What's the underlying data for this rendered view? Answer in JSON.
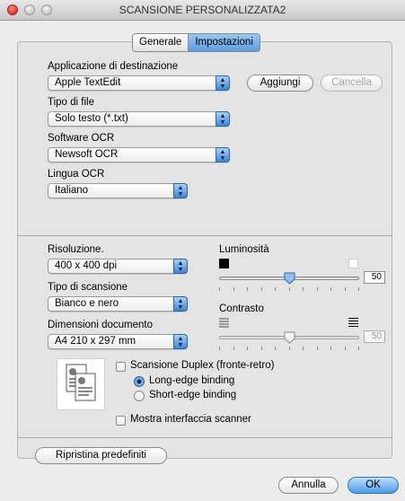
{
  "window": {
    "title": "SCANSIONE PERSONALIZZATA2"
  },
  "tabs": {
    "general": "Generale",
    "settings": "Impostazioni"
  },
  "destination": {
    "label": "Applicazione di destinazione",
    "value": "Apple TextEdit",
    "add_button": "Aggiungi",
    "delete_button": "Cancella"
  },
  "file_type": {
    "label": "Tipo di file",
    "value": "Solo testo (*.txt)"
  },
  "ocr_software": {
    "label": "Software OCR",
    "value": "Newsoft OCR"
  },
  "ocr_language": {
    "label": "Lingua OCR",
    "value": "Italiano"
  },
  "resolution": {
    "label": "Risoluzione.",
    "value": "400 x 400 dpi"
  },
  "scan_type": {
    "label": "Tipo di scansione",
    "value": "Bianco e nero"
  },
  "document_size": {
    "label": "Dimensioni documento",
    "value": "A4  210 x 297 mm"
  },
  "brightness": {
    "label": "Luminosità",
    "value": "50",
    "level": 0.5,
    "enabled": true
  },
  "contrast": {
    "label": "Contrasto",
    "value": "50",
    "level": 0.5,
    "enabled": false
  },
  "duplex": {
    "checkbox_label": "Scansione Duplex (fronte-retro)",
    "checked": false,
    "long_edge": "Long-edge binding",
    "short_edge": "Short-edge binding",
    "selected": "long_edge"
  },
  "show_scanner_interface": {
    "label": "Mostra interfaccia scanner",
    "checked": false
  },
  "restore_defaults_button": "Ripristina predefiniti",
  "footer": {
    "cancel_button": "Annulla",
    "ok_button": "OK"
  },
  "colors": {
    "accent": "#4c9ae8",
    "close": "#d9362b"
  }
}
